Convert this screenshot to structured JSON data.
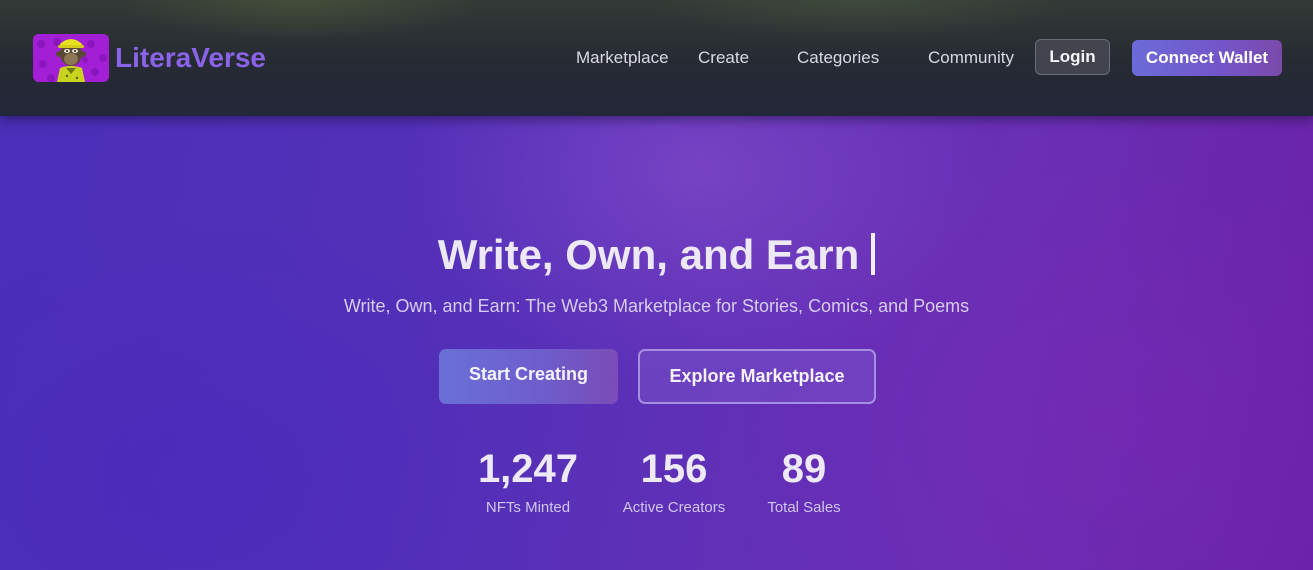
{
  "brand": {
    "name": "LiteraVerse",
    "logo_icon": "ape-avatar-icon"
  },
  "nav": {
    "links": [
      {
        "label": "Marketplace"
      },
      {
        "label": "Create"
      },
      {
        "label": "Categories"
      },
      {
        "label": "Community"
      }
    ],
    "login_label": "Login",
    "wallet_label": "Connect Wallet"
  },
  "hero": {
    "title": "Write, Own, and Earn",
    "subtitle": "Write, Own, and Earn: The Web3 Marketplace for Stories, Comics, and Poems",
    "primary_cta": "Start Creating",
    "secondary_cta": "Explore Marketplace"
  },
  "stats": [
    {
      "value": "1,247",
      "label": "NFTs Minted"
    },
    {
      "value": "156",
      "label": "Active Creators"
    },
    {
      "value": "89",
      "label": "Total Sales"
    }
  ],
  "colors": {
    "brand_accent": "#8a63e8",
    "hero_background_start": "#4a2fb8",
    "hero_background_end": "#6a22a8",
    "navbar_background": "#262a33"
  }
}
